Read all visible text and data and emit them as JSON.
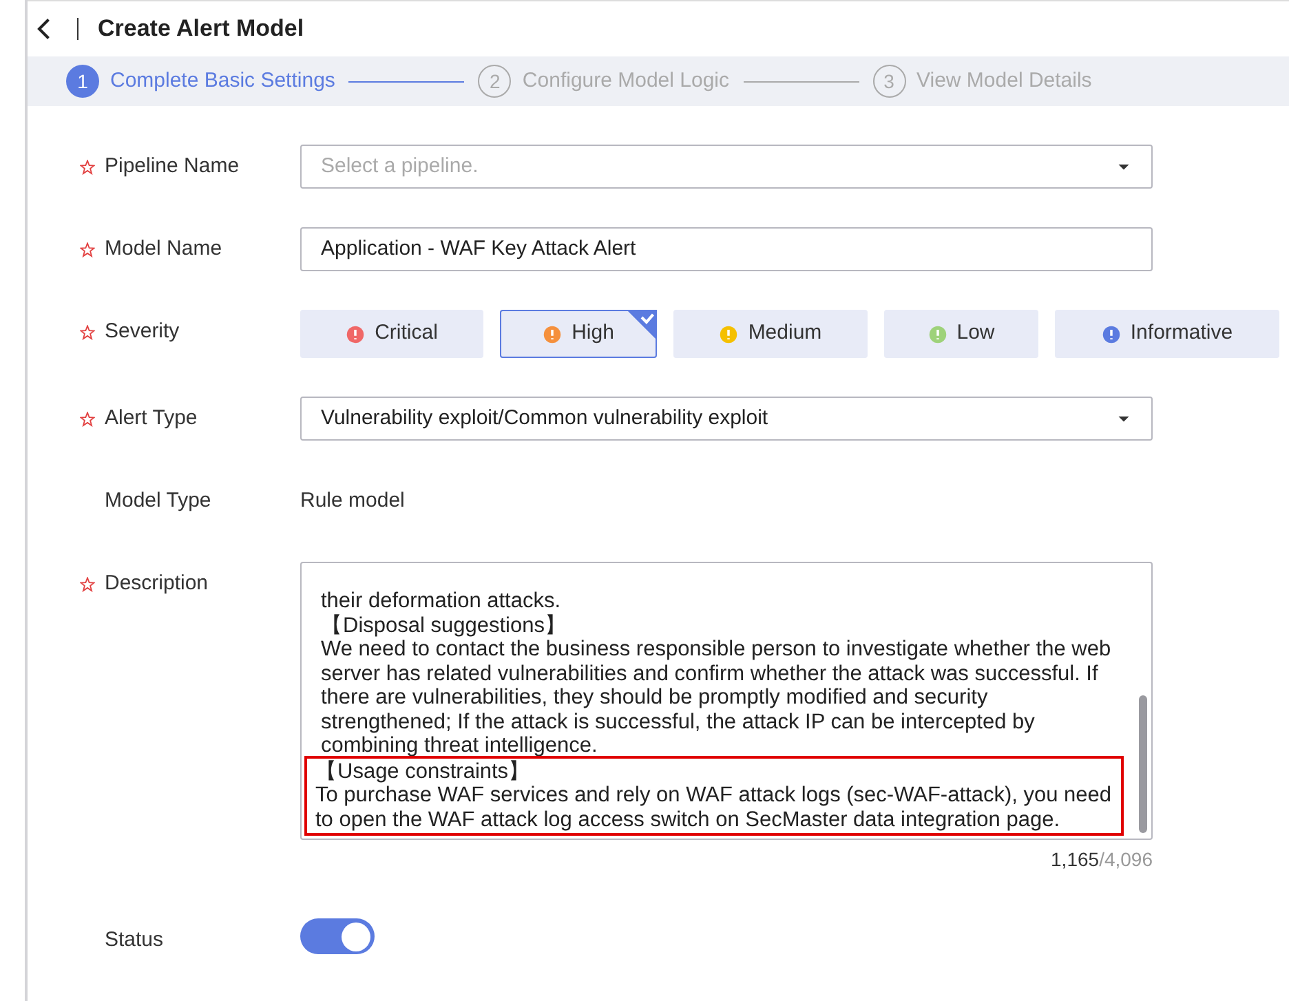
{
  "header": {
    "title": "Create Alert Model"
  },
  "steps": [
    {
      "number": "1",
      "label": "Complete Basic Settings",
      "selected": true
    },
    {
      "number": "2",
      "label": "Configure Model Logic",
      "selected": false
    },
    {
      "number": "3",
      "label": "View Model Details",
      "selected": false
    }
  ],
  "form": {
    "fields": [
      {
        "kind": "select",
        "label": "Pipeline Name",
        "required": true,
        "placeholder": "Select a pipeline."
      },
      {
        "kind": "input",
        "label": "Model Name",
        "required": true,
        "value": "Application - WAF Key Attack Alert"
      },
      {
        "kind": "severity",
        "label": "Severity",
        "required": true,
        "options": [
          {
            "label": "Critical",
            "color": "#f06767",
            "selected": false
          },
          {
            "label": "High",
            "color": "#f5903d",
            "selected": true
          },
          {
            "label": "Medium",
            "color": "#f5c000",
            "selected": false
          },
          {
            "label": "Low",
            "color": "#9ed27a",
            "selected": false
          },
          {
            "label": "Informative",
            "color": "#5b7be0",
            "selected": false
          }
        ]
      },
      {
        "kind": "select",
        "label": "Alert Type",
        "required": true,
        "value": "Vulnerability exploit/Common vulnerability exploit"
      },
      {
        "kind": "static",
        "label": "Model Type",
        "required": false,
        "value": "Rule model"
      },
      {
        "kind": "textarea",
        "label": "Description",
        "required": true,
        "paragraphs": [
          {
            "text": "their deformation attacks.",
            "highlighted": false
          },
          {
            "text": "【Disposal suggestions】\nWe need to contact the business responsible person to investigate whether the web server has related vulnerabilities and confirm whether the attack was successful. If there are vulnerabilities, they should be promptly modified and security strengthened; If the attack is successful, the attack IP can be intercepted by combining threat intelligence.",
            "highlighted": false
          },
          {
            "text": "【Usage constraints】\nTo purchase WAF services and rely on WAF attack logs (sec-WAF-attack), you need to open the WAF attack log access switch on SecMaster data integration page.",
            "highlighted": true
          }
        ],
        "count": "1,165",
        "limit": "/4,096"
      },
      {
        "kind": "switch",
        "label": "Status",
        "required": false,
        "on": true
      }
    ]
  }
}
